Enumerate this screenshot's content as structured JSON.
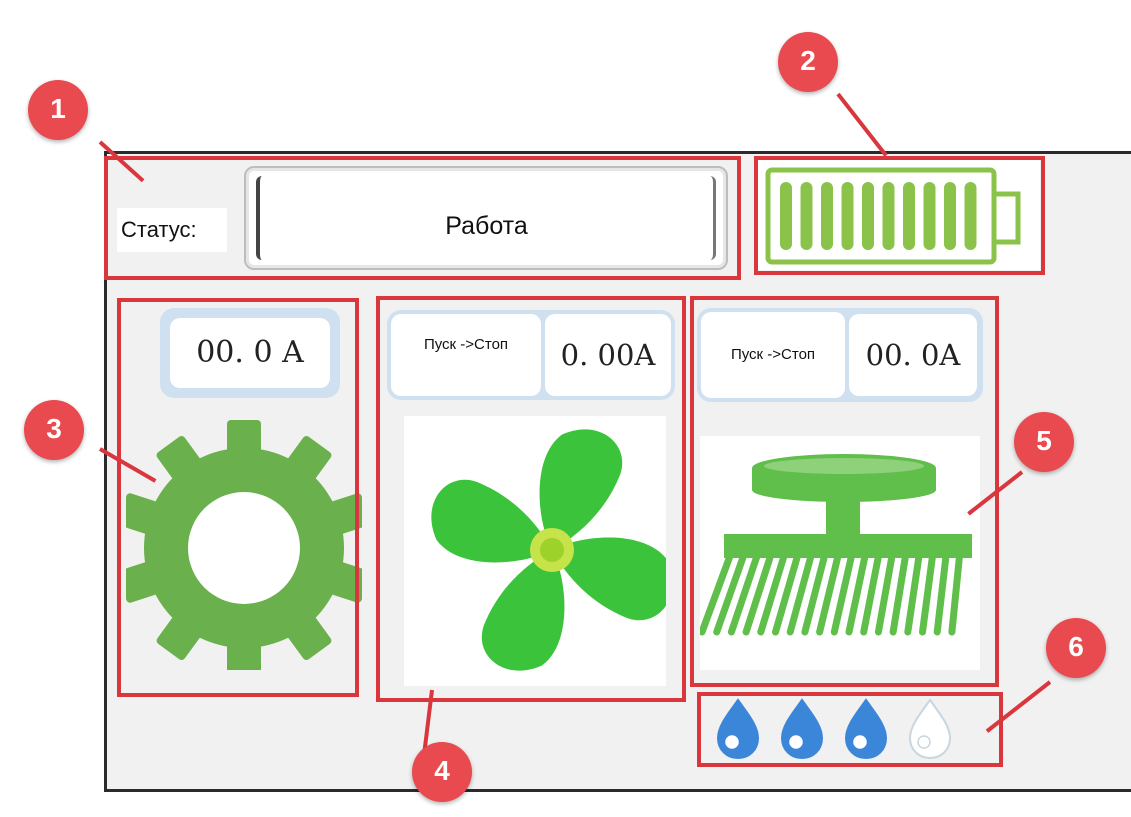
{
  "callouts": [
    "1",
    "2",
    "3",
    "4",
    "5",
    "6"
  ],
  "status": {
    "label": "Статус:",
    "value": "Работа"
  },
  "battery": {
    "level": 1.0,
    "color": "#8bc34a"
  },
  "gear_module": {
    "current": "00. 0  A",
    "icon": "gear-icon",
    "color": "#6ab04c"
  },
  "fan_module": {
    "label": "Пуск ->Стоп",
    "current": "0. 00A",
    "icon": "fan-icon",
    "color": "#3cc33c"
  },
  "brush_module": {
    "label": "Пуск ->Стоп",
    "current": "00. 0A",
    "icon": "brush-icon",
    "color": "#5fbf4a"
  },
  "water_level": {
    "filled": 3,
    "total": 4,
    "icon": "water-drop-icon",
    "color": "#3b86d8"
  },
  "colors": {
    "callout": "#e84a4f",
    "highlight_box": "#d9363e",
    "readout_bg": "#cfe0f1"
  }
}
